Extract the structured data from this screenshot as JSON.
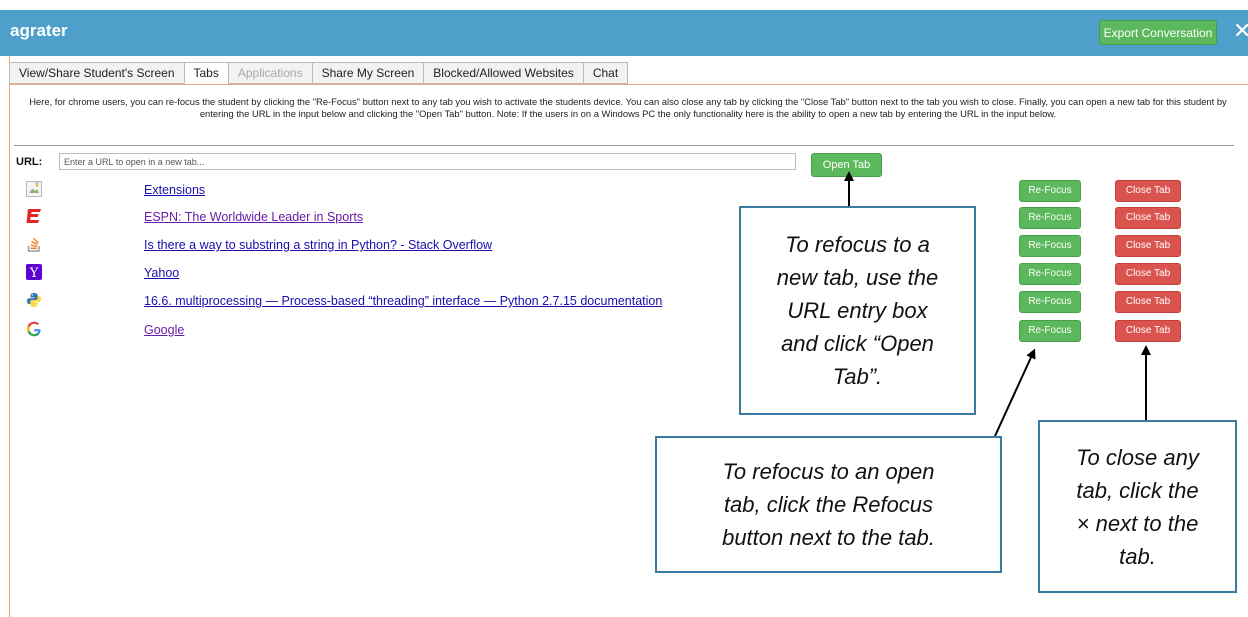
{
  "app": {
    "title": "agrater",
    "export_label": "Export Conversation",
    "close_glyph": "✕"
  },
  "tabs": [
    {
      "label": "View/Share Student's Screen",
      "state": "normal"
    },
    {
      "label": "Tabs",
      "state": "active"
    },
    {
      "label": "Applications",
      "state": "disabled"
    },
    {
      "label": "Share My Screen",
      "state": "normal"
    },
    {
      "label": "Blocked/Allowed Websites",
      "state": "normal"
    },
    {
      "label": "Chat",
      "state": "normal"
    }
  ],
  "instructions": "Here, for chrome users, you can re-focus the student by clicking the \"Re-Focus\" button next to any tab you wish to activate the students device. You can also close any tab by clicking the \"Close Tab\" button next to the tab you wish to close. Finally, you can open a new tab for this student by entering the URL in the input below and clicking the \"Open Tab\" button. Note: If the users in on a Windows PC the only functionality here is the ability to open a new tab by entering the URL in the input below.",
  "url": {
    "label": "URL:",
    "placeholder": "Enter a URL to open in a new tab...",
    "open_label": "Open Tab"
  },
  "buttons": {
    "refocus": "Re-Focus",
    "close_tab": "Close Tab"
  },
  "open_tabs": [
    {
      "title": "Extensions",
      "icon": "broken-image-icon",
      "visited": false
    },
    {
      "title": "ESPN: The Worldwide Leader in Sports",
      "icon": "espn-icon",
      "visited": true
    },
    {
      "title": "Is there a way to substring a string in Python? - Stack Overflow",
      "icon": "stackoverflow-icon",
      "visited": false
    },
    {
      "title": "Yahoo",
      "icon": "yahoo-icon",
      "visited": false
    },
    {
      "title": "16.6. multiprocessing — Process-based “threading” interface — Python 2.7.15 documentation",
      "icon": "python-icon",
      "visited": false
    },
    {
      "title": "Google",
      "icon": "google-icon",
      "visited": true
    }
  ],
  "callouts": {
    "new_tab": [
      "To refocus to a",
      "new tab, use the",
      "URL entry box",
      "and click “Open",
      "Tab”."
    ],
    "refocus": [
      "To refocus to an open",
      "tab, click the Refocus",
      "button next to the tab."
    ],
    "close": [
      "To close any",
      "tab, click the",
      "× next to the",
      "tab."
    ]
  },
  "colors": {
    "header": "#4e9fc9",
    "green_button": "#5cb85c",
    "red_button": "#d9534f",
    "callout_border": "#3b7ba3",
    "link": "#1a0dab",
    "visited_link": "#681da8"
  }
}
